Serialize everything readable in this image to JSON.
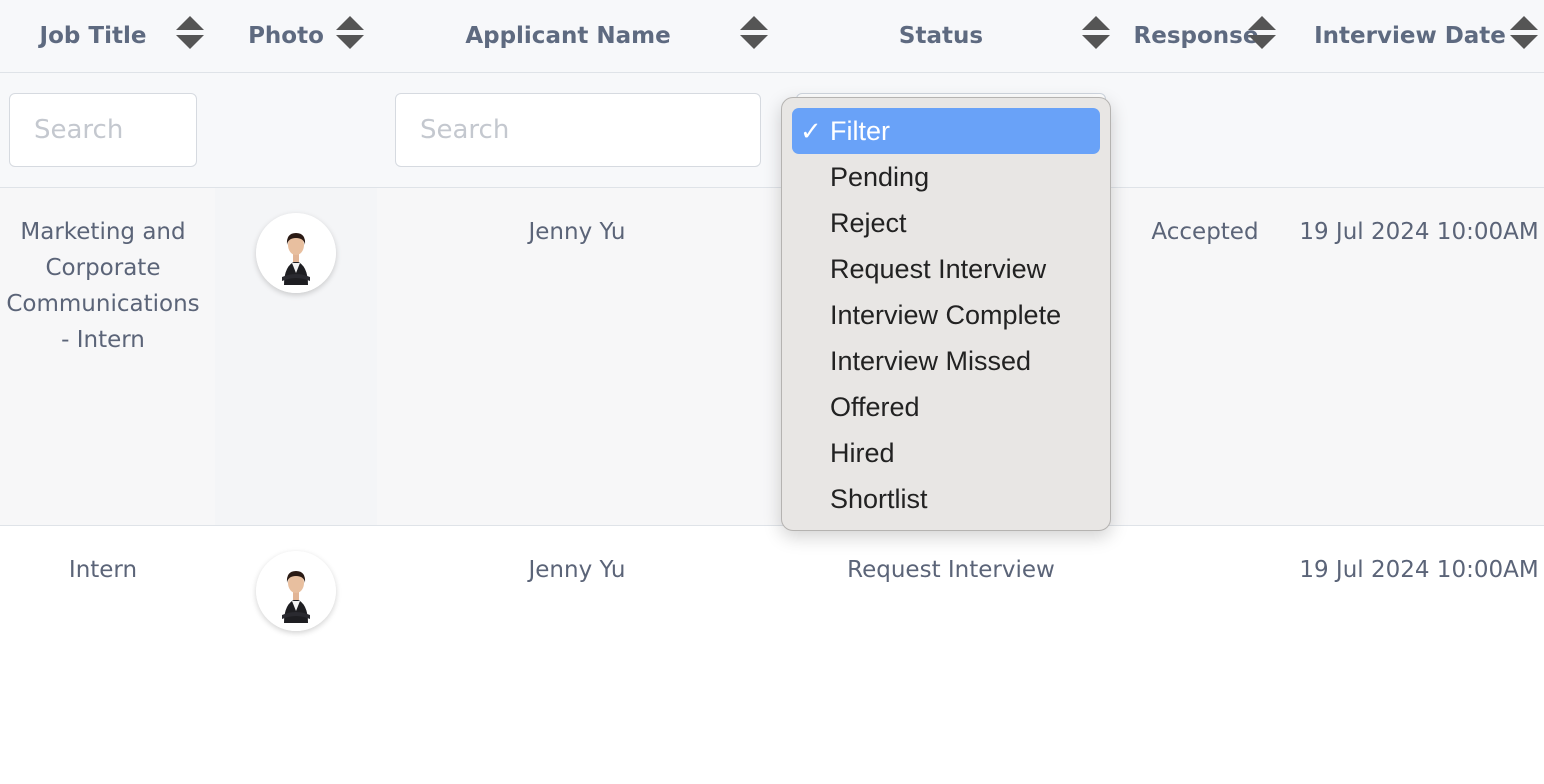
{
  "columns": [
    {
      "key": "job_title",
      "label": "Job Title",
      "sortable": true
    },
    {
      "key": "photo",
      "label": "Photo",
      "sortable": true
    },
    {
      "key": "applicant_name",
      "label": "Applicant Name",
      "sortable": true
    },
    {
      "key": "status",
      "label": "Status",
      "sortable": true
    },
    {
      "key": "response",
      "label": "Response",
      "sortable": true
    },
    {
      "key": "interview_date",
      "label": "Interview Date",
      "sortable": true
    }
  ],
  "filters": {
    "job_title": {
      "value": "",
      "placeholder": "Search"
    },
    "applicant_name": {
      "value": "",
      "placeholder": "Search"
    }
  },
  "status_dropdown": {
    "selected": "Filter",
    "check_glyph": "✓",
    "options": [
      "Filter",
      "Pending",
      "Reject",
      "Request Interview",
      "Interview Complete",
      "Interview Missed",
      "Offered",
      "Hired",
      "Shortlist"
    ]
  },
  "rows": [
    {
      "job_title": "Marketing and Corporate Communications - Intern",
      "applicant_name": "Jenny Yu",
      "status": "",
      "response": "Accepted",
      "interview_date": "19 Jul 2024 10:00AM"
    },
    {
      "job_title": "Intern",
      "applicant_name": "Jenny Yu",
      "status": "Request Interview",
      "response": "",
      "interview_date": "19 Jul 2024 10:00AM"
    }
  ],
  "colors": {
    "header_bg": "#f7f8fa",
    "text": "#5b6478",
    "selected_option": "#69a2f8",
    "dropdown_bg": "#e8e6e4"
  }
}
